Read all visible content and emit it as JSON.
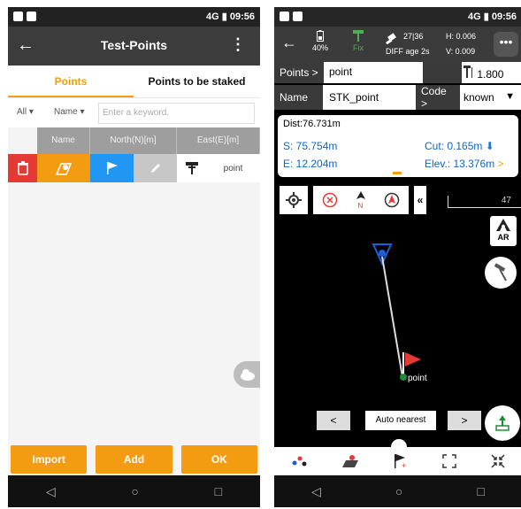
{
  "left": {
    "status": {
      "time": "09:56",
      "network": "4G"
    },
    "title": "Test-Points",
    "tabs": [
      "Points",
      "Points to be staked"
    ],
    "filter": {
      "type": "All",
      "field": "Name",
      "placeholder": "Enter a keyword."
    },
    "columns": [
      "Name",
      "North(N)[m]",
      "East(E)[m]"
    ],
    "row": {
      "name": "point"
    },
    "buttons": [
      "Import",
      "Add",
      "OK"
    ],
    "colors": {
      "accent": "#f39c12",
      "delete": "#e53935",
      "flag": "#2196f3",
      "edit": "#bdbdbd"
    }
  },
  "right": {
    "status": {
      "time": "09:56",
      "network": "4G"
    },
    "top": {
      "battery": "40%",
      "fix": "Fix",
      "sats": "27|36",
      "diff": "DIFF age 2s",
      "h": "H: 0.006",
      "v": "V: 0.009"
    },
    "points_label": "Points >",
    "point_value": "point",
    "height_value": "1.800",
    "name_label": "Name",
    "name_value": "STK_point",
    "code_label": "Code >",
    "code_value": "known",
    "card": {
      "dist": "Dist:76.731m",
      "s": "S: 75.754m",
      "e": "E: 12.204m",
      "cut": "Cut: 0.165m",
      "elev": "Elev.: 13.376m"
    },
    "scale": "47",
    "ar_label": "AR",
    "map_label": "point",
    "nav_mode": "Auto nearest",
    "nav_prev": "<",
    "nav_next": ">"
  }
}
